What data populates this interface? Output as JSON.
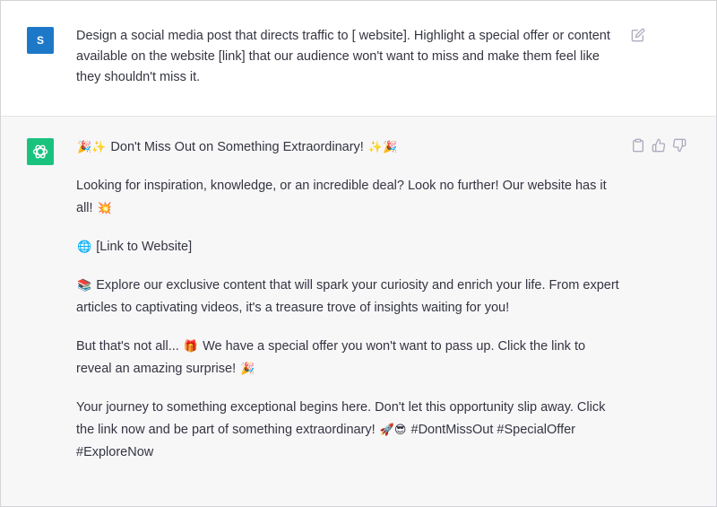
{
  "conversation": {
    "user": {
      "avatar_initial": "S",
      "message": "Design a social media post that directs traffic to [ website]. Highlight a special offer or content available on the website [link] that our audience won't want to miss and make them feel like they shouldn't miss it."
    },
    "assistant": {
      "avatar_icon": "openai-logo-icon",
      "title": {
        "lead_emoji": "🎉✨",
        "text": "Don't Miss Out on Something Extraordinary!",
        "trail_emoji": "✨🎉"
      },
      "p1": {
        "text": "Looking for inspiration, knowledge, or an incredible deal? Look no further! Our website has it all!",
        "emoji": "💥"
      },
      "p2": {
        "emoji": "🌐",
        "text": "[Link to Website]"
      },
      "p3": {
        "emoji": "📚",
        "text": "Explore our exclusive content that will spark your curiosity and enrich your life. From expert articles to captivating videos, it's a treasure trove of insights waiting for you!"
      },
      "p4": {
        "text_a": "But that's not all...",
        "emoji_a": "🎁",
        "text_b": "We have a special offer you won't want to pass up. Click the link to reveal an amazing surprise!",
        "emoji_b": "🎉"
      },
      "p5": {
        "text": "Your journey to something exceptional begins here. Don't let this opportunity slip away. Click the link now and be part of something extraordinary!",
        "emoji": "🚀😎",
        "hashtags": "#DontMissOut #SpecialOffer #ExploreNow"
      }
    }
  },
  "icons": {
    "edit": "edit-icon",
    "copy": "clipboard-icon",
    "like": "thumbs-up-icon",
    "dislike": "thumbs-down-icon"
  },
  "colors": {
    "user_avatar": "#1e78c8",
    "bot_avatar": "#19c37d",
    "assistant_bg": "#f7f7f8",
    "text": "#343541",
    "icon": "#acacbe"
  }
}
